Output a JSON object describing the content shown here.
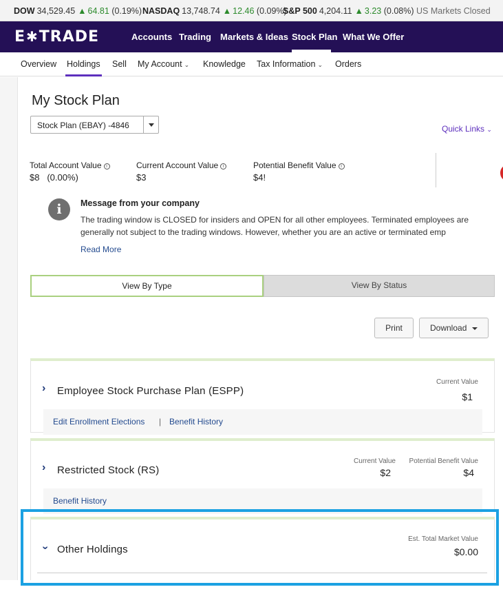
{
  "ticker": {
    "dow": {
      "name": "DOW",
      "value": "34,529.45",
      "change": "64.81",
      "pct": "(0.19%)"
    },
    "nasdaq": {
      "name": "NASDAQ",
      "value": "13,748.74",
      "change": "12.46",
      "pct": "(0.09%)"
    },
    "sp500": {
      "name": "S&P 500",
      "value": "4,204.11",
      "change": "3.23",
      "pct": "(0.08%)"
    },
    "status": "US Markets Closed"
  },
  "brand": {
    "logo_left": "E",
    "logo_right": "TRADE"
  },
  "main_nav": [
    "Accounts",
    "Trading",
    "Markets & Ideas",
    "Stock Plan",
    "What We Offer"
  ],
  "sub_nav": [
    "Overview",
    "Holdings",
    "Sell",
    "My Account",
    "Knowledge",
    "Tax Information",
    "Orders"
  ],
  "page": {
    "title": "My Stock Plan",
    "plan_select": "Stock Plan (EBAY) -4846",
    "quick_links": "Quick Links"
  },
  "stats": {
    "total_label": "Total Account Value",
    "total_value": "$8",
    "total_pct": "(0.00%)",
    "current_label": "Current Account Value",
    "current_value": "$3",
    "potential_label": "Potential Benefit Value",
    "potential_value": "$4!"
  },
  "message": {
    "title": "Message from your company",
    "line1": "The trading window is CLOSED for insiders and OPEN for all other employees. Terminated employees are",
    "line2": "generally not subject to the trading windows. However, whether you are an active or terminated emp",
    "read_more": "Read More"
  },
  "view_toggle": {
    "by_type": "View By Type",
    "by_status": "View By Status"
  },
  "actions": {
    "print": "Print",
    "download": "Download"
  },
  "espp": {
    "title": "Employee Stock Purchase Plan (ESPP)",
    "cv_label": "Current Value",
    "cv_value": "$1",
    "link1": "Edit Enrollment Elections",
    "separator": "|",
    "link2": "Benefit History"
  },
  "rs": {
    "title": "Restricted Stock (RS)",
    "cv_label": "Current Value",
    "cv_value": "$2",
    "pb_label": "Potential Benefit Value",
    "pb_value": "$4",
    "link1": "Benefit History"
  },
  "other": {
    "title": "Other Holdings",
    "mv_label": "Est. Total Market Value",
    "mv_value": "$0.00"
  },
  "colors": {
    "brand": "#241056",
    "accent": "#5d2fbd",
    "highlight": "#1ba1e2",
    "up": "#2c8a2c"
  }
}
